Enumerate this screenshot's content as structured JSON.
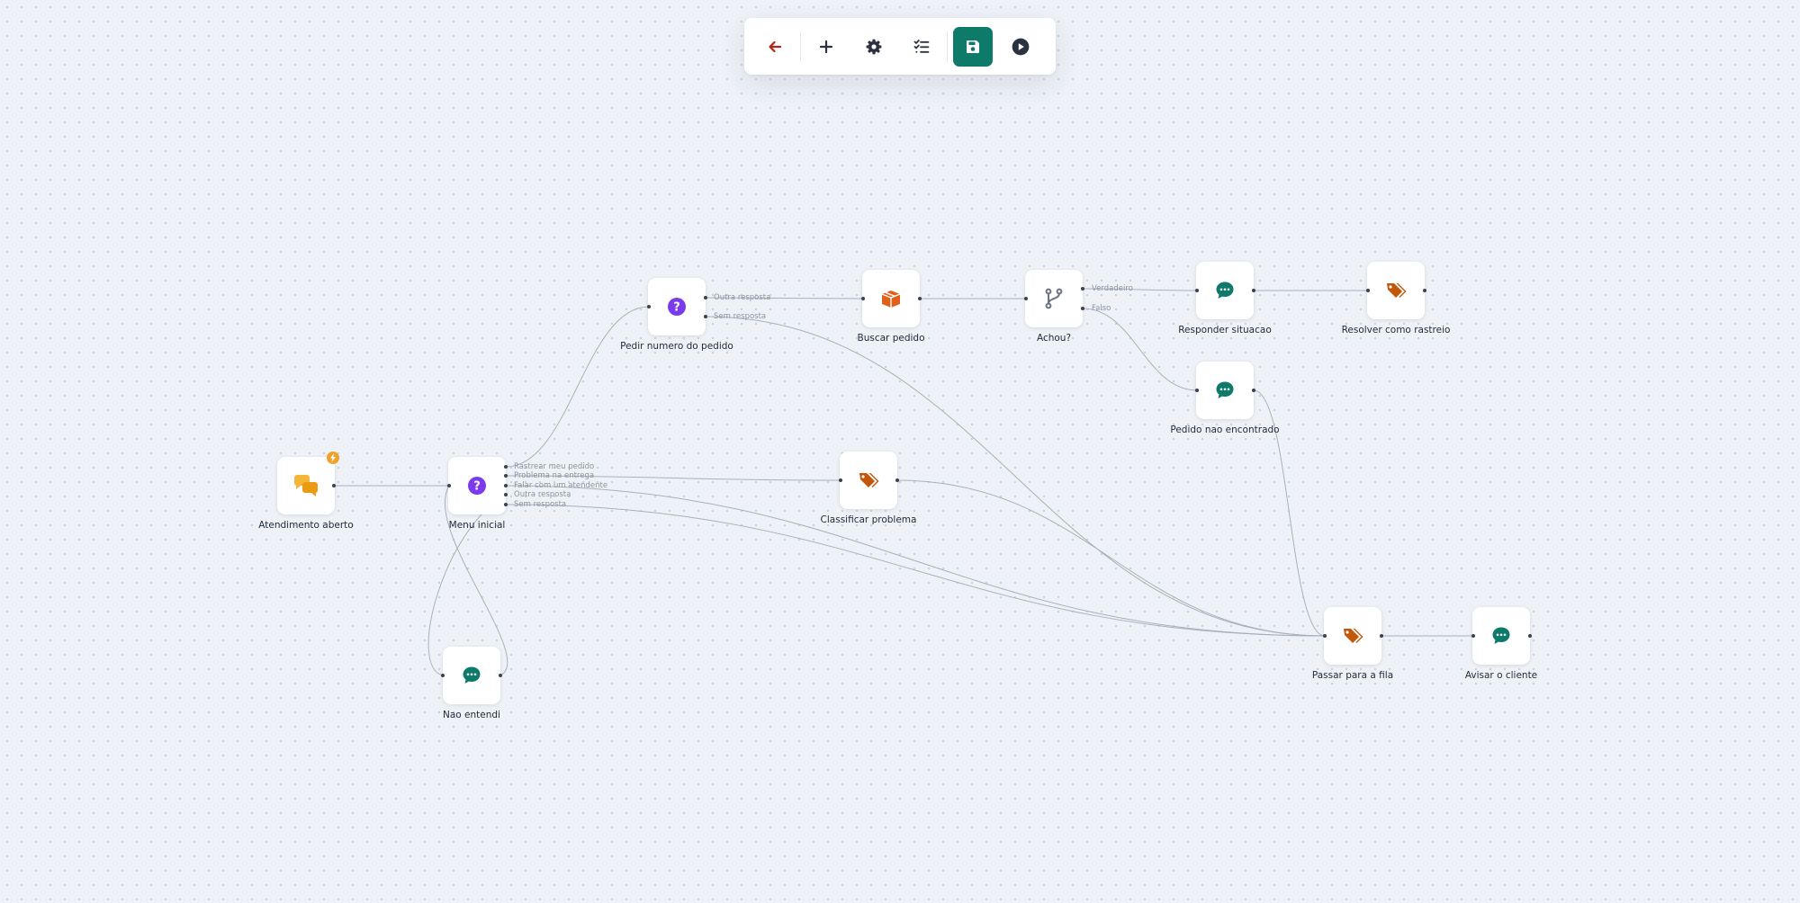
{
  "toolbar": {
    "buttons": [
      {
        "name": "back-button",
        "icon": "arrow-left-icon",
        "color": "#b42318"
      },
      {
        "name": "add-node-button",
        "icon": "plus-icon",
        "color": "#2b3240"
      },
      {
        "name": "settings-button",
        "icon": "gear-icon",
        "color": "#2b3240"
      },
      {
        "name": "checklist-button",
        "icon": "checklist-icon",
        "color": "#2b3240"
      },
      {
        "name": "save-button",
        "icon": "floppy-disk-icon",
        "color": "#ffffff",
        "background": "#0e7a6a"
      },
      {
        "name": "run-button",
        "icon": "play-circle-icon",
        "color": "#2b3240"
      }
    ]
  },
  "nodes": {
    "atendimento_aberto": {
      "label": "Atendimento aberto",
      "icon": "chat-bubbles-icon",
      "color": "#f0a12a",
      "badge": "lightning-icon"
    },
    "menu_inicial": {
      "label": "Menu inicial",
      "icon": "question-icon",
      "color": "#7c3aed",
      "outputs": [
        "Rastrear meu pedido",
        "Problema na entrega",
        "Falar com um atendente",
        "Outra resposta",
        "Sem resposta"
      ]
    },
    "nao_entendi": {
      "label": "Nao entendi",
      "icon": "message-icon",
      "color": "#0e7a6a"
    },
    "pedir_numero": {
      "label": "Pedir numero do pedido",
      "icon": "question-icon",
      "color": "#7c3aed",
      "outputs": [
        "Outra resposta",
        "Sem resposta"
      ]
    },
    "buscar_pedido": {
      "label": "Buscar pedido",
      "icon": "box-icon",
      "color": "#e0601a"
    },
    "achou": {
      "label": "Achou?",
      "icon": "branch-icon",
      "color": "#6b7280",
      "outputs": [
        "Verdadeiro",
        "Falso"
      ]
    },
    "responder_situacao": {
      "label": "Responder situacao",
      "icon": "message-icon",
      "color": "#0e7a6a"
    },
    "resolver_rastreio": {
      "label": "Resolver como rastreio",
      "icon": "tags-icon",
      "color": "#c2570c"
    },
    "pedido_nao_encontrado": {
      "label": "Pedido nao encontrado",
      "icon": "message-icon",
      "color": "#0e7a6a"
    },
    "classificar_problema": {
      "label": "Classificar problema",
      "icon": "tags-icon",
      "color": "#c2570c"
    },
    "passar_fila": {
      "label": "Passar para a fila",
      "icon": "tags-icon",
      "color": "#c2570c"
    },
    "avisar_cliente": {
      "label": "Avisar o cliente",
      "icon": "message-icon",
      "color": "#0e7a6a"
    }
  }
}
